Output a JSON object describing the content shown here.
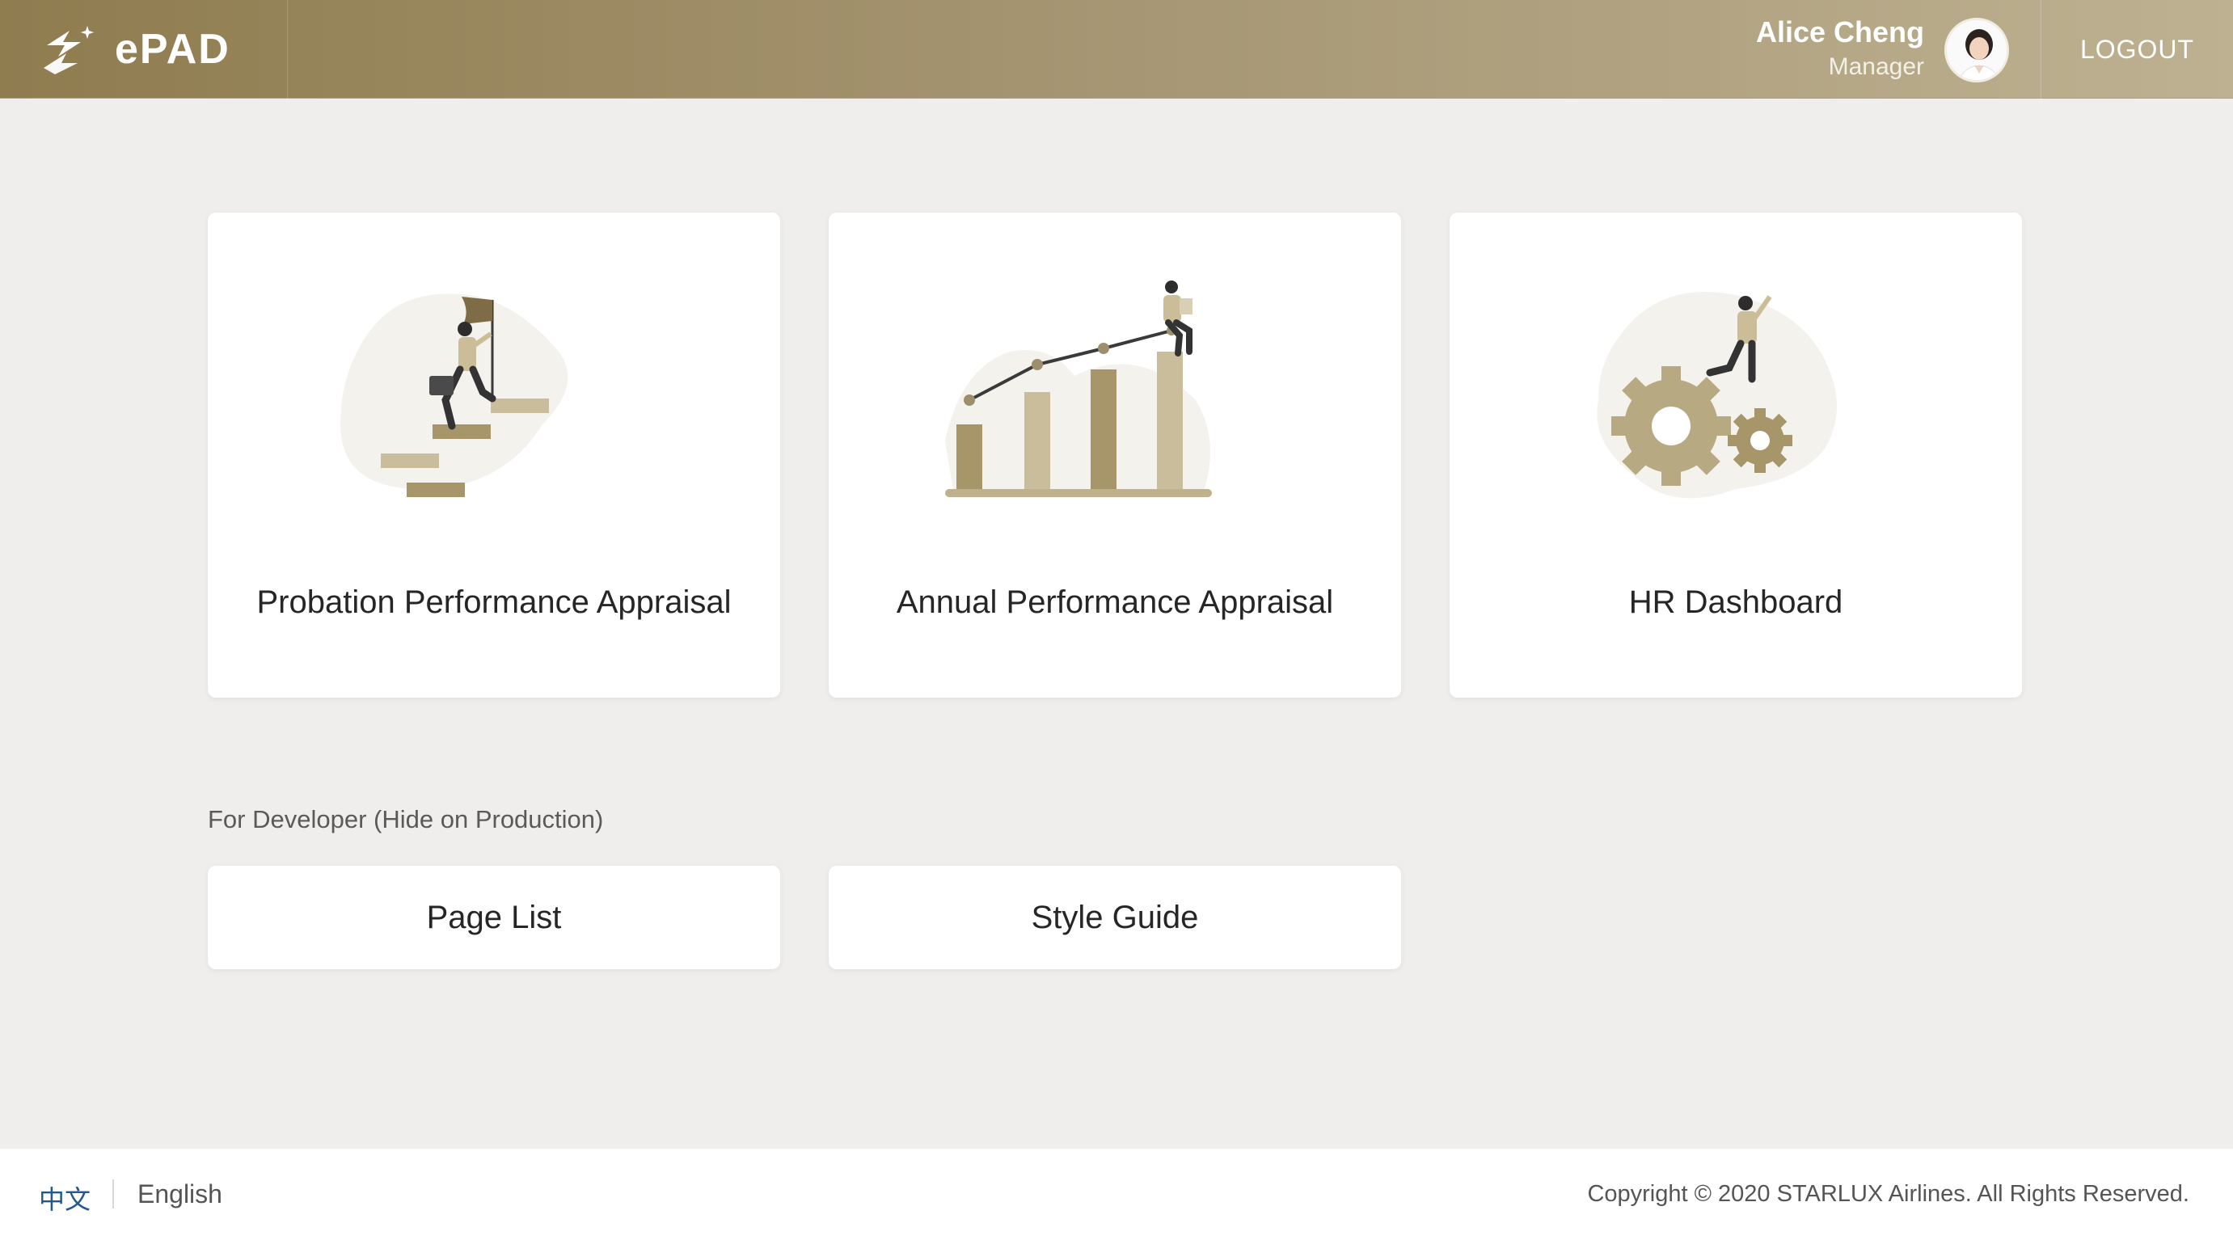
{
  "header": {
    "logo_text": "ePAD",
    "user": {
      "name": "Alice Cheng",
      "role": "Manager"
    },
    "logout_label": "LOGOUT"
  },
  "cards": [
    {
      "title": "Probation Performance Appraisal",
      "illustration": "climbing-stairs-with-flag"
    },
    {
      "title": "Annual Performance Appraisal",
      "illustration": "rising-bar-chart"
    },
    {
      "title": "HR Dashboard",
      "illustration": "person-on-gears"
    }
  ],
  "developer": {
    "label": "For Developer (Hide on Production)",
    "links": [
      {
        "label": "Page List"
      },
      {
        "label": "Style Guide"
      }
    ]
  },
  "footer": {
    "lang_zh": "中文",
    "lang_en": "English",
    "copyright": "Copyright © 2020 STARLUX Airlines. All Rights Reserved."
  },
  "colors": {
    "header_start": "#8f7c4f",
    "header_end": "#bdb191",
    "background": "#efeeec",
    "accent_gold": "#b3a680",
    "link_blue": "#23578f"
  }
}
